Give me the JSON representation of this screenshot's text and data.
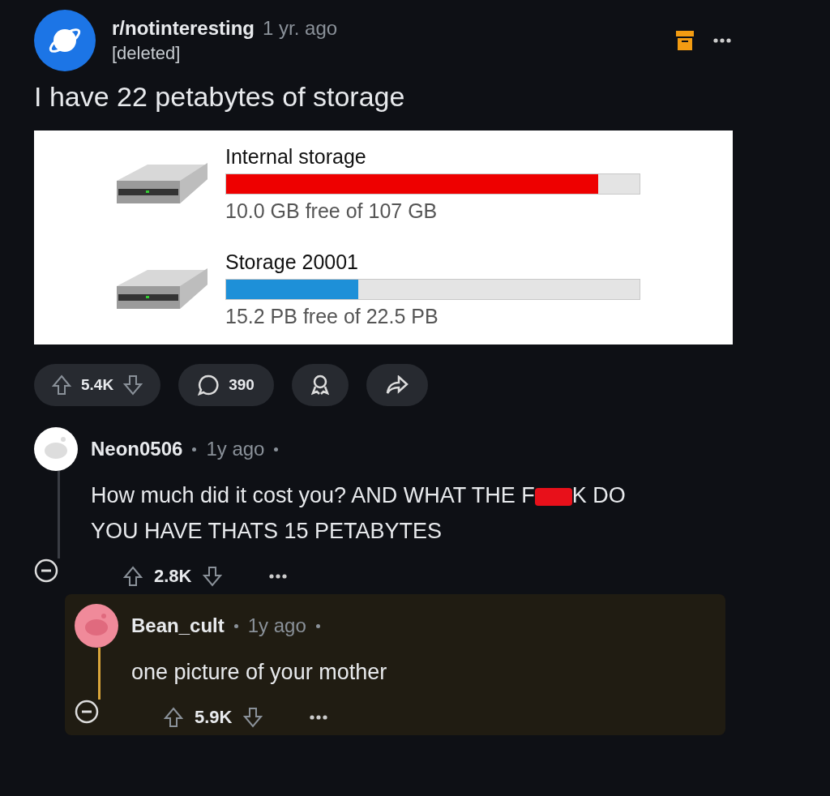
{
  "post": {
    "subreddit": "r/notinteresting",
    "time": "1 yr. ago",
    "author": "[deleted]",
    "title": "I have 22 petabytes of storage",
    "saved": true,
    "image": {
      "drives": [
        {
          "name": "Internal storage",
          "level": 0.9,
          "color": "#ee0000",
          "caption": "10.0 GB free of 107 GB"
        },
        {
          "name": "Storage 20001",
          "level": 0.32,
          "color": "#1e90d8",
          "caption": "15.2 PB free of 22.5 PB"
        }
      ]
    },
    "votes": "5.4K",
    "comments": "390"
  },
  "comments": [
    {
      "user": "Neon0506",
      "time": "1y ago",
      "color": "#ffffff",
      "highlighted": false,
      "text_before": "How much did it cost you? AND WHAT THE F",
      "censored": true,
      "text_after": "K DO YOU HAVE THATS 15 PETABYTES",
      "votes": "2.8K"
    },
    {
      "user": "Bean_cult",
      "time": "1y ago",
      "color": "#f08a9a",
      "highlighted": true,
      "text_before": "one picture of your mother",
      "censored": false,
      "votes": "5.9K"
    }
  ]
}
